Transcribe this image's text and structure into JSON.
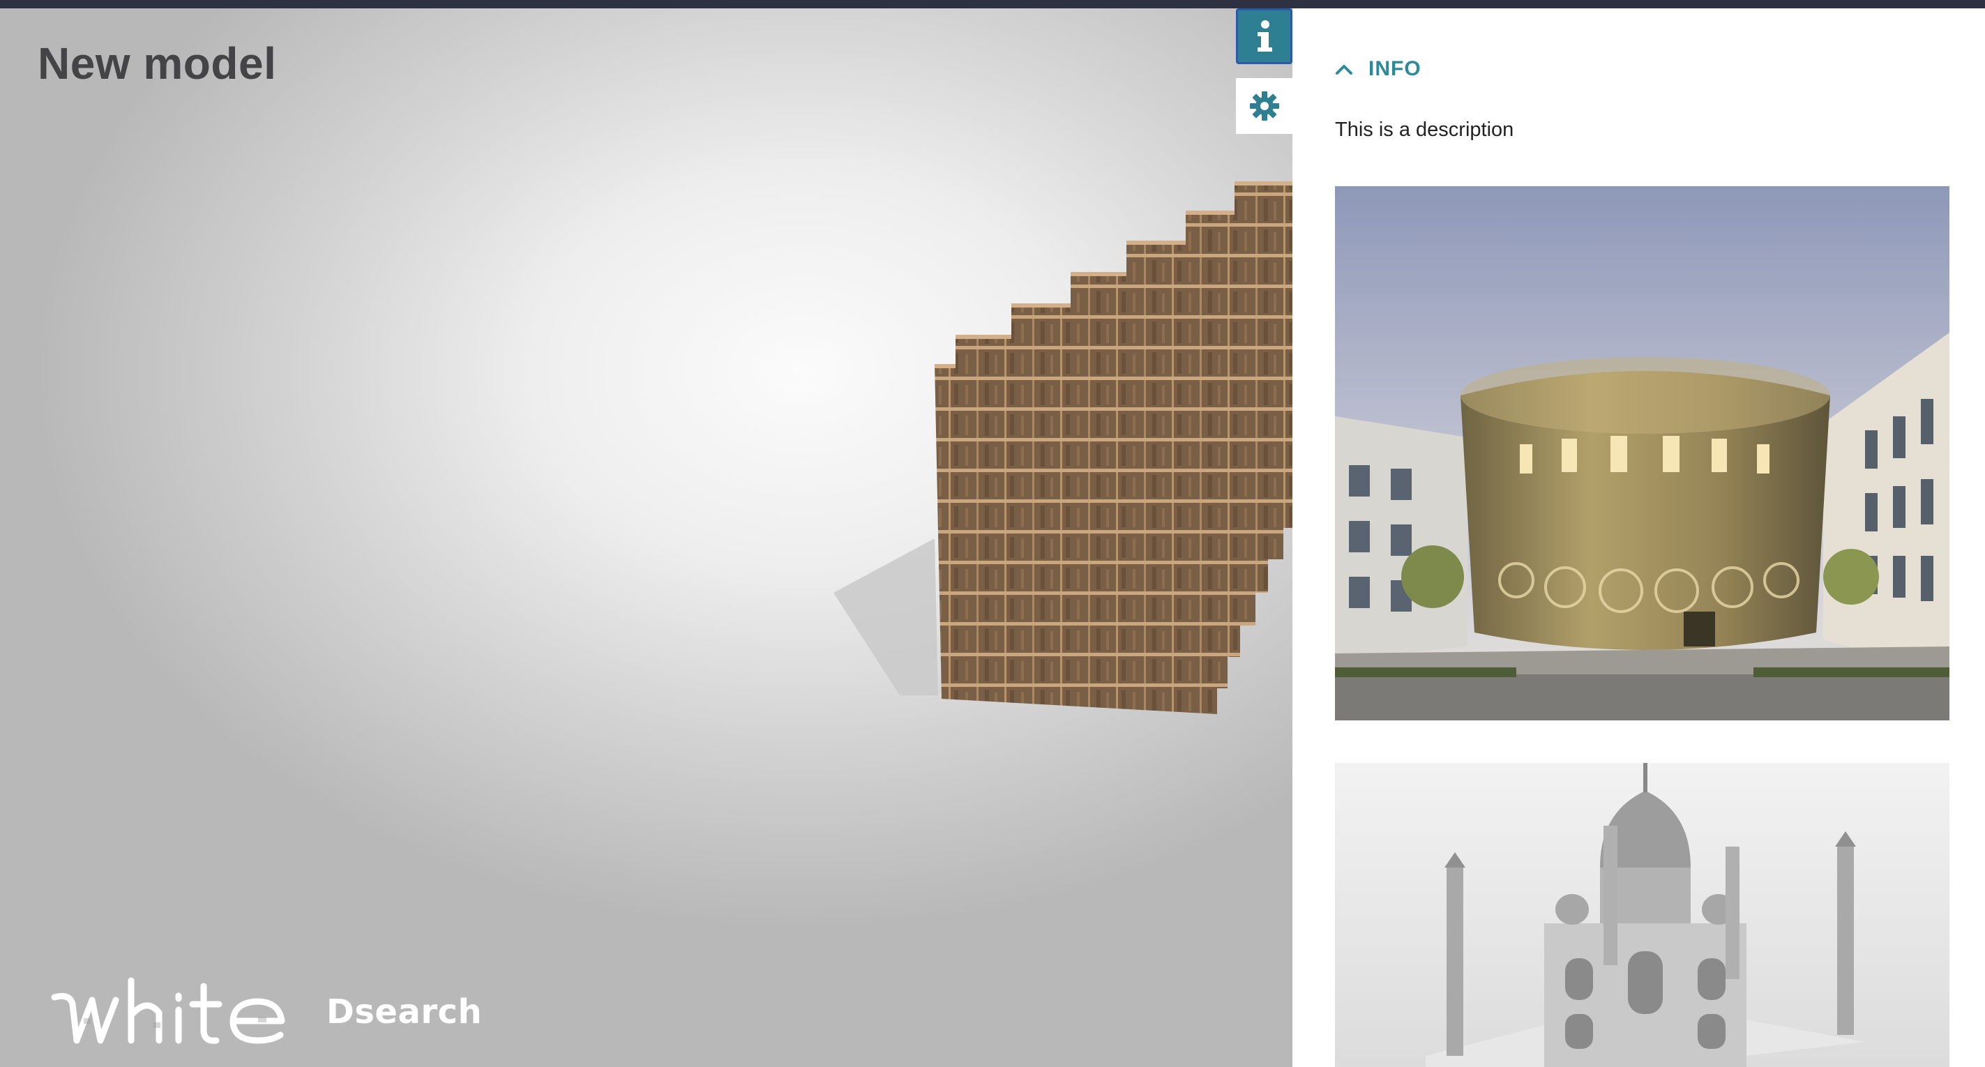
{
  "viewer": {
    "title": "New model"
  },
  "logo": {
    "mark": "white",
    "product": "Dsearch"
  },
  "toolbar": {
    "info_icon": "info-icon",
    "settings_icon": "gear-icon"
  },
  "panel": {
    "section_label": "INFO",
    "section_icon": "chevron-up-icon",
    "description": "This is a description",
    "images": [
      {
        "subject": "golden cylindrical building"
      },
      {
        "subject": "taj mahal model"
      }
    ]
  },
  "colors": {
    "accent": "#2e8a9a",
    "topbar": "#2d3142",
    "title": "#444446"
  }
}
